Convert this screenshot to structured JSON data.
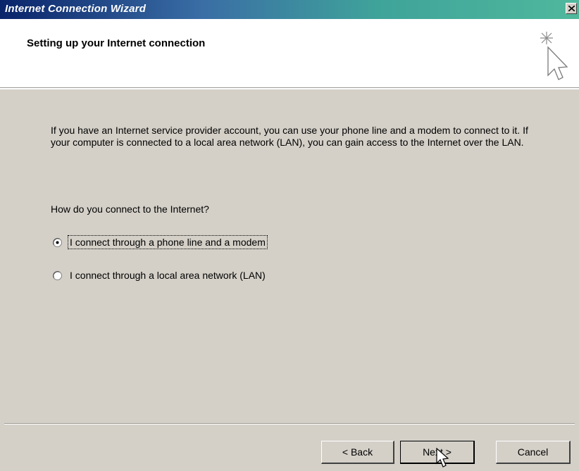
{
  "window": {
    "title": "Internet Connection Wizard",
    "close_symbol": "×"
  },
  "header": {
    "title": "Setting up your Internet connection",
    "icon": "sparkle-cursor-icon"
  },
  "body": {
    "intro": "If you have an Internet service provider account, you can use your phone line and a modem to connect to it. If your computer is connected to a local area network (LAN), you can gain access to the Internet over the LAN.",
    "question": "How do you connect to the Internet?",
    "options": [
      {
        "label": "I connect through a phone line and a modem",
        "selected": true
      },
      {
        "label": "I connect through a local area network (LAN)",
        "selected": false
      }
    ]
  },
  "buttons": {
    "back": "< Back",
    "next": "Next >",
    "cancel": "Cancel"
  },
  "colors": {
    "face": "#d4d0c8",
    "title_start": "#0a246a",
    "title_end": "#4fb89c",
    "header_bg": "#ffffff"
  }
}
